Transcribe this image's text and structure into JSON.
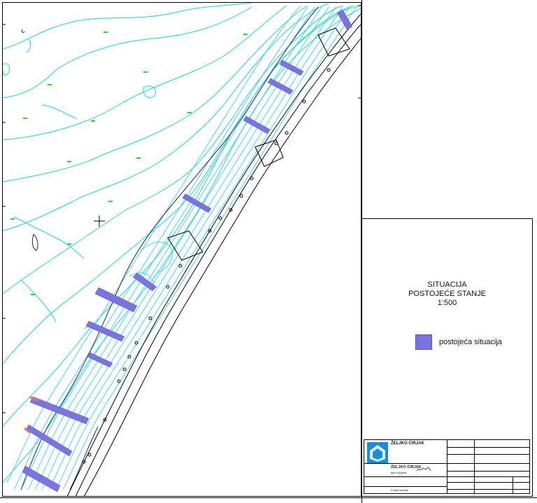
{
  "title_block": {
    "line1": "SITUACIJA",
    "line2": "POSTOJEĆE STANJE",
    "scale": "1:500"
  },
  "legend": {
    "label": "postojeća situacija",
    "color": "#7b73e0"
  },
  "stamp": {
    "firm_name": "ŽELJKO ĆIRJAK",
    "author_name": "ŽELJKO ĆIRJAK",
    "author_title": "dipl.ing.građ.",
    "phase": "Projekt sanacije"
  }
}
